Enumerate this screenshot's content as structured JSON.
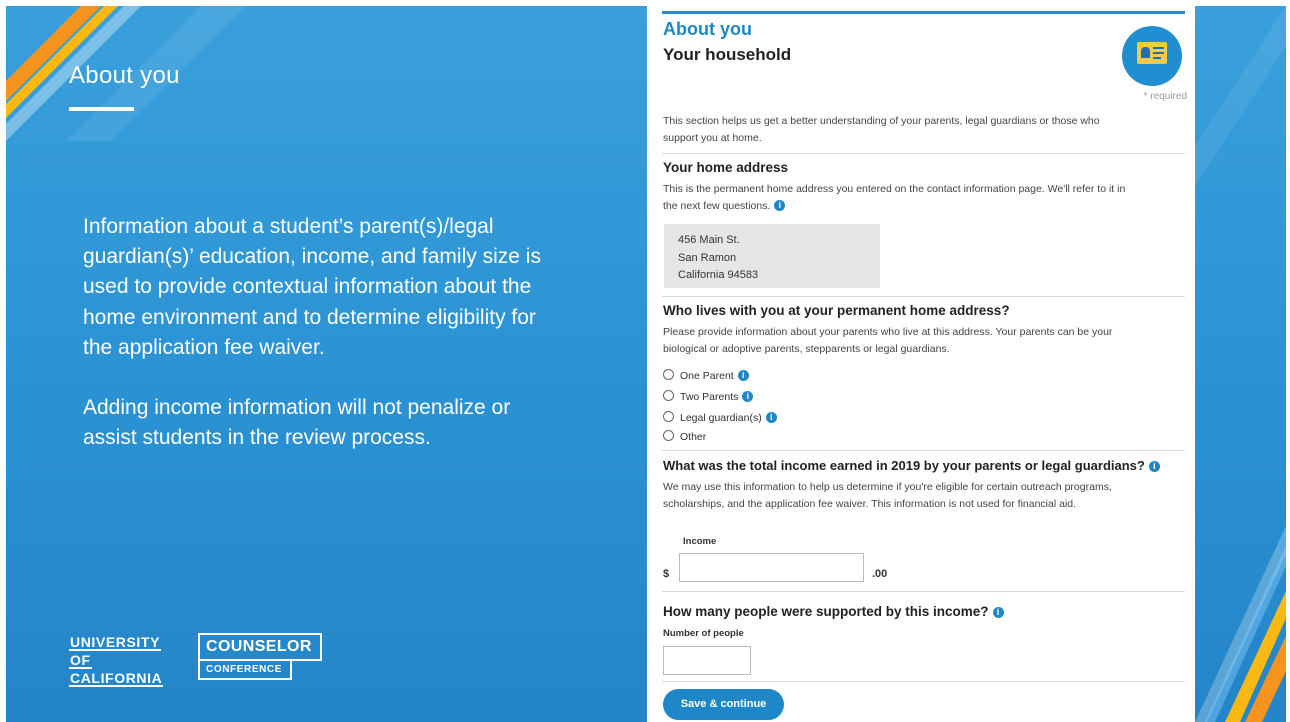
{
  "slide": {
    "title": "About  you",
    "body_paragraph_1": "Information about a student’s parent(s)/legal guardian(s)’ education, income, and family size is used to provide contextual information about the home environment and to determine eligibility for the application fee waiver.",
    "body_paragraph_2": "Adding income information will  not penalize or assist students in the review process.",
    "logo_uc": [
      "UNIVERSITY",
      "OF",
      "CALIFORNIA"
    ],
    "logo_cc_top": "COUNSELOR",
    "logo_cc_bottom": "CONFERENCE",
    "colors": {
      "background": "#2a92d3",
      "accent_orange": "#f7941d",
      "accent_yellow": "#fdb913"
    }
  },
  "form": {
    "section_title": "About you",
    "page_title": "Your household",
    "avatar_icon": "id-card-icon",
    "required_note": "* required",
    "intro": "This section helps us get a better understanding of your parents, legal guardians or those who support you at home.",
    "home_address": {
      "heading": "Your home address",
      "description": "This is the permanent home address you entered on the contact information page. We'll refer to it in the next few questions.",
      "lines": [
        "456 Main St.",
        "San Ramon",
        "California 94583"
      ]
    },
    "lives_with": {
      "heading": "Who lives with you at your permanent home address?",
      "description": "Please provide information about your parents who live at this address. Your parents can be your biological or adoptive parents, stepparents or legal guardians.",
      "options": [
        "One Parent",
        "Two Parents",
        "Legal guardian(s)",
        "Other"
      ]
    },
    "income": {
      "heading": "What was the total income earned in 2019 by your parents or legal guardians?",
      "description": "We may use this information to help us determine if you're eligible for certain outreach programs, scholarships, and the application fee waiver. This information is not used for financial aid.",
      "label": "Income",
      "currency": "$",
      "cents": ".00",
      "value": ""
    },
    "people": {
      "heading": "How many people were supported by this income?",
      "label": "Number of people",
      "value": ""
    },
    "submit_label": "Save & continue"
  }
}
